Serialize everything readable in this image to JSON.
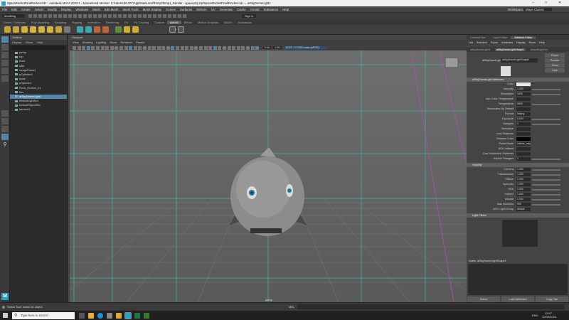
{
  "titlebar": {
    "title": "SpaceRocketFinalRocket.mb* - Autodesk MAYA 2023.1 - Educational Version: C:\\Users\\Jk1207\\AppData\\Local\\Temp\\Temp1_Render - spaceproj.zip\\SpaceRocketFinal\\Rocket.mb --- aiSkyDomeLight1"
  },
  "menubar": {
    "items": [
      "File",
      "Edit",
      "Create",
      "Select",
      "Modify",
      "Display",
      "Windows",
      "Mesh",
      "Edit Mesh",
      "Mesh Tools",
      "Mesh Display",
      "Curves",
      "Surfaces",
      "Deform",
      "UV",
      "Generate",
      "Cache",
      "Arnold",
      "Substance",
      "Help"
    ],
    "workspace_label": "Workspace:",
    "workspace_value": "Maya Classic"
  },
  "statusline": {
    "mode": "Modeling",
    "sign_in": "Sign In"
  },
  "shelf_tabs": {
    "items": [
      "Curves / Surfaces",
      "Poly Modeling",
      "Sculpting",
      "Rigging",
      "Animation",
      "Rendering",
      "FX",
      "FX Caching",
      "Custom",
      "Arnold",
      "Bifrost",
      "Motion Graphics",
      "MASH",
      "Substance"
    ],
    "active": "Arnold"
  },
  "outliner": {
    "title": "Outliner",
    "menus": [
      "Display",
      "Show",
      "Help"
    ],
    "items": [
      {
        "label": "persp",
        "sel": false
      },
      {
        "label": "top",
        "sel": false
      },
      {
        "label": "front",
        "sel": false
      },
      {
        "label": "side",
        "sel": false
      },
      {
        "label": "imagePlane1",
        "sel": false
      },
      {
        "label": "pCylinder1",
        "sel": false
      },
      {
        "label": "body",
        "sel": false
      },
      {
        "label": "pSphere1",
        "sel": false
      },
      {
        "label": "Rock_Rocket_01",
        "sel": false
      },
      {
        "label": "fins",
        "sel": false
      },
      {
        "label": "aiSkyDomeLight1",
        "sel": true
      },
      {
        "label": "defaultLightSet",
        "sel": false
      },
      {
        "label": "defaultObjectSet",
        "sel": false
      },
      {
        "label": "lambert1",
        "sel": false
      }
    ]
  },
  "viewport": {
    "title": "Viewport",
    "menus": [
      "View",
      "Shading",
      "Lighting",
      "Show",
      "Renderer",
      "Panels"
    ],
    "camera_label": "persp",
    "gamma_value": "0.00",
    "exposure_value": "1.00",
    "colorspace": "ACES 1.0 SDR-video (sRGB)"
  },
  "attribute_editor": {
    "tabs": [
      "Channel Box",
      "Layer Editor",
      "Attribute Editor"
    ],
    "active_tab": "Attribute Editor",
    "menus": [
      "List",
      "Selected",
      "Focus",
      "Attributes",
      "Display",
      "Show",
      "Help"
    ],
    "node_tabs": [
      "aiSkyDomeLight1",
      "aiSkyDomeLightShape1",
      "defaultLightSet"
    ],
    "node_label": "aiSkyDomeLight:",
    "node_value": "aiSkyDomeLightShape1",
    "buttons": [
      "Focus",
      "Presets",
      "Show",
      "Hide"
    ],
    "section1": "aiSkyDomeLight Attributes",
    "attrs1": [
      {
        "label": "Color",
        "value": ""
      },
      {
        "label": "Intensity",
        "value": "1.000"
      },
      {
        "label": "Resolution",
        "value": "1000"
      },
      {
        "label": "Use Color Temperature",
        "value": ""
      },
      {
        "label": "Temperature",
        "value": "6500"
      },
      {
        "label": "Illuminates By Default",
        "value": ""
      },
      {
        "label": "Format",
        "value": "latlong"
      },
      {
        "label": "Exposure",
        "value": "0.000"
      },
      {
        "label": "Samples",
        "value": "1"
      },
      {
        "label": "Normalize",
        "value": ""
      },
      {
        "label": "Cast Shadows",
        "value": ""
      },
      {
        "label": "Shadow Color",
        "value": ""
      },
      {
        "label": "Portal Mode",
        "value": "interior_only"
      },
      {
        "label": "AOV Indirect",
        "value": ""
      },
      {
        "label": "Cast Volumetric Shadows",
        "value": ""
      },
      {
        "label": "Aspect Triangles",
        "value": "1"
      }
    ],
    "section2": "Visibility",
    "attrs2": [
      {
        "label": "Camera",
        "value": "1.000"
      },
      {
        "label": "Transmission",
        "value": "1.000"
      },
      {
        "label": "Diffuse",
        "value": "1.000"
      },
      {
        "label": "Specular",
        "value": "1.000"
      },
      {
        "label": "SSS",
        "value": "1.000"
      },
      {
        "label": "Indirect",
        "value": "1.000"
      },
      {
        "label": "Volume",
        "value": "1.000"
      },
      {
        "label": "Max Bounces",
        "value": "999"
      },
      {
        "label": "AOV Light Group",
        "value": "default"
      }
    ],
    "section3": "Light Filters",
    "notes_label": "Notes: aiSkyDomeLightShape1",
    "bottom_buttons": [
      "Select",
      "Load Attributes",
      "Copy Tab"
    ]
  },
  "helpline": {
    "text": "Select Tool: select an object",
    "mode": "MEL"
  },
  "taskbar": {
    "search_placeholder": "Type here to search",
    "time": "13:57",
    "date": "12/05/2023",
    "lang": "ENG"
  },
  "colors": {
    "accent": "#5285a6",
    "maya_blue": "#29a2c6",
    "grid": "#3fb8a8"
  }
}
